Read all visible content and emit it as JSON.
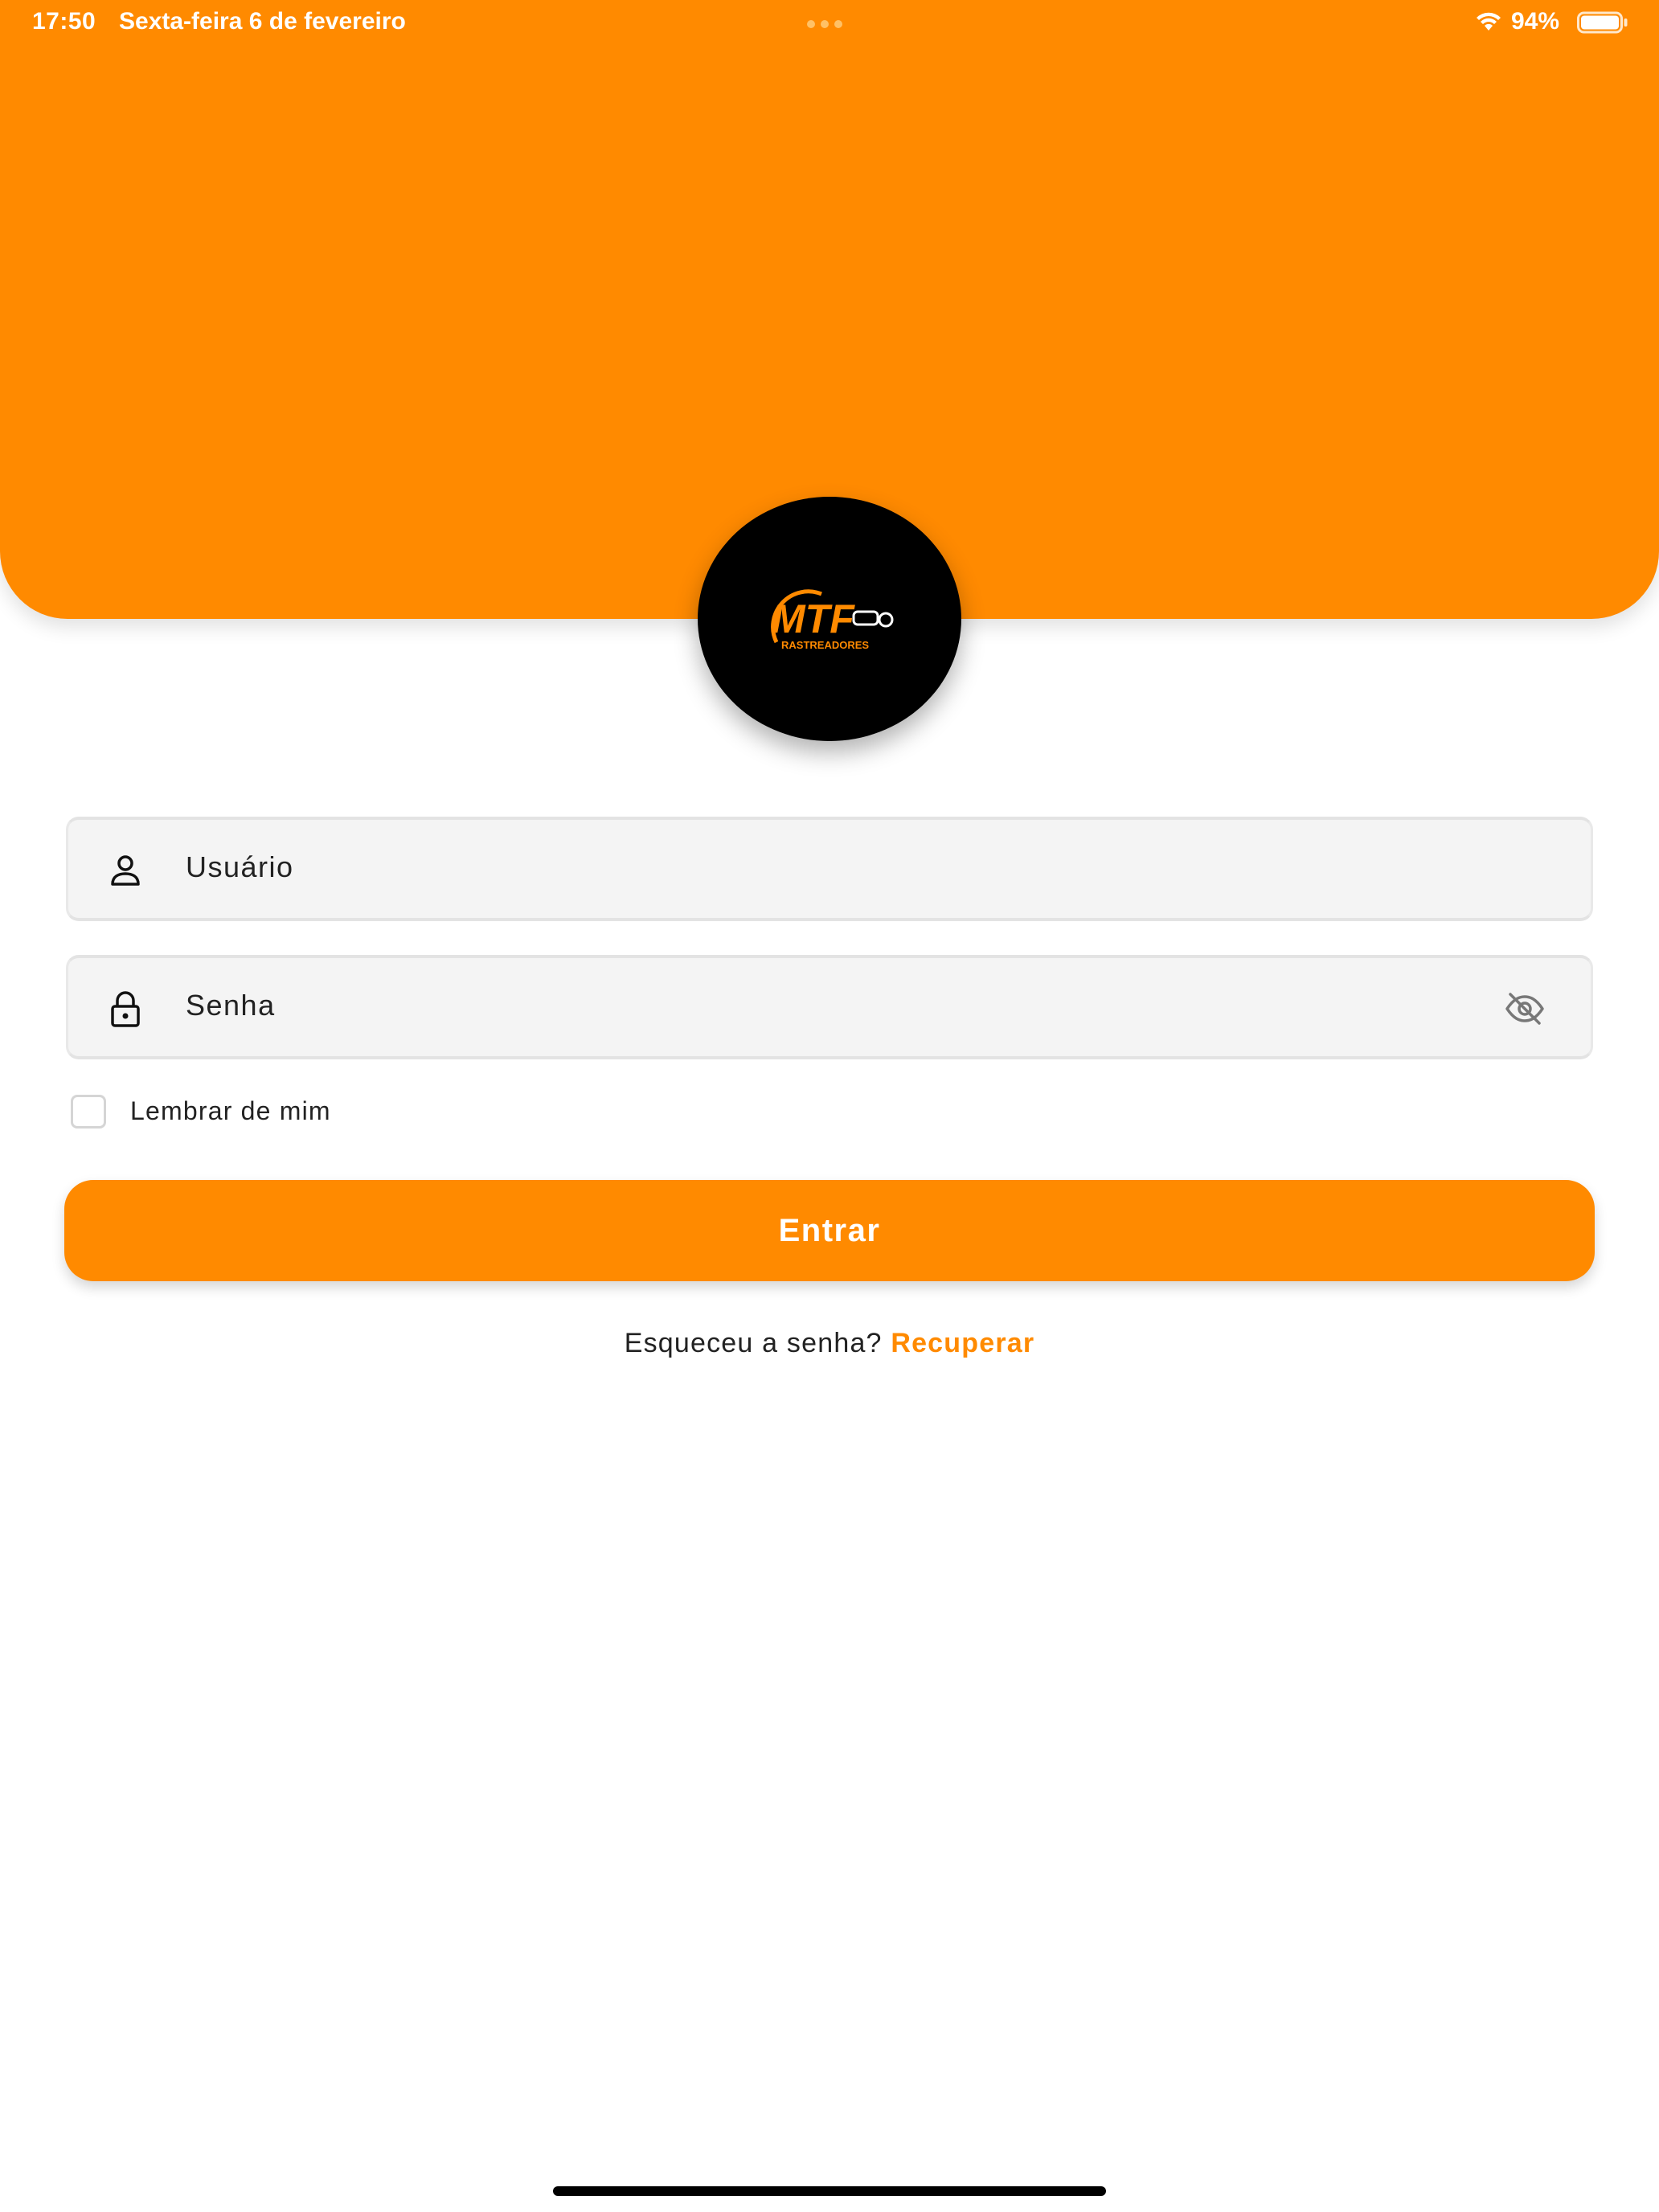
{
  "status_bar": {
    "time": "17:50",
    "date": "Sexta-feira 6 de fevereiro",
    "battery_percent": "94%",
    "wifi_icon": "wifi-icon",
    "battery_icon": "battery-icon",
    "battery_level": 0.94
  },
  "logo": {
    "name": "mtf-rastreadores-logo",
    "text": "MTF",
    "subtext": "RASTREADORES"
  },
  "form": {
    "username": {
      "placeholder": "Usuário",
      "icon": "user-icon"
    },
    "password": {
      "placeholder": "Senha",
      "icon": "lock-icon",
      "toggle_icon": "eye-off-icon"
    },
    "remember_me": {
      "label": "Lembrar de mim",
      "checked": false
    },
    "submit_label": "Entrar"
  },
  "forgot": {
    "text": "Esqueceu a senha?",
    "link_label": "Recuperar"
  },
  "colors": {
    "accent": "#FF8A00",
    "background": "#FFFFFF",
    "field_background": "#F4F4F4",
    "text": "#222222"
  }
}
